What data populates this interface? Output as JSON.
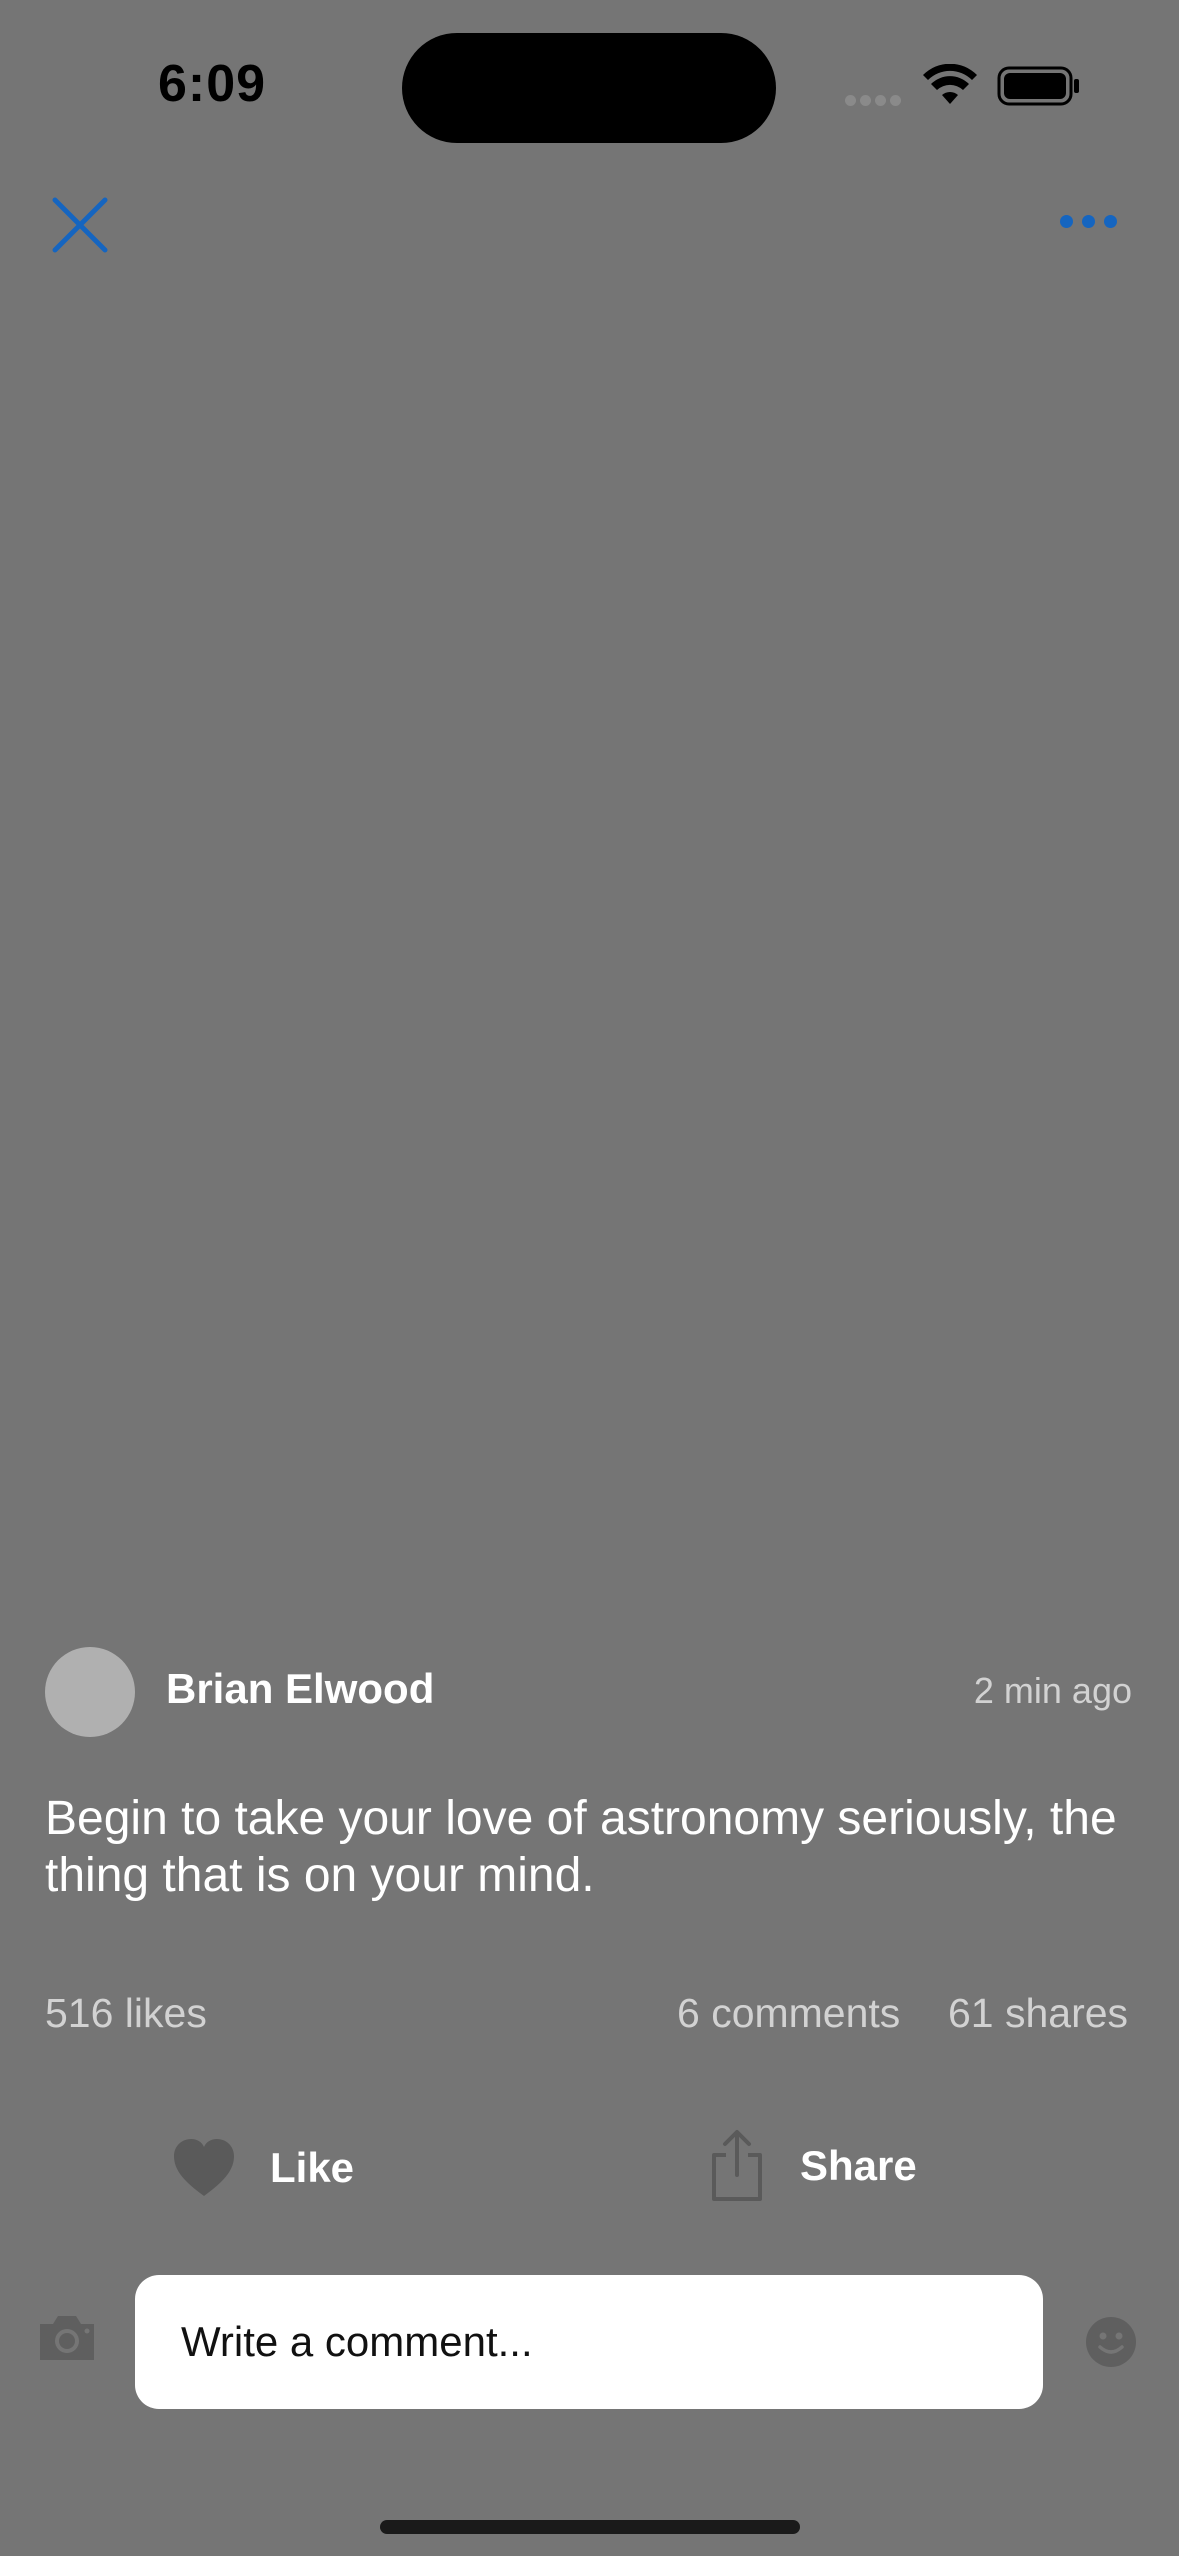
{
  "status_bar": {
    "time": "6:09"
  },
  "nav": {
    "close_icon": "close-icon",
    "more_icon": "more-horizontal-icon",
    "accent_color": "#1565c0"
  },
  "post": {
    "author_name": "Brian Elwood",
    "time_ago": "2 min ago",
    "text": "Begin to take your love of astronomy seriously, the thing that is on your mind.",
    "likes": "516 likes",
    "comments": "6 comments",
    "shares": "61 shares"
  },
  "actions": {
    "like_label": "Like",
    "like_icon": "heart-icon",
    "share_label": "Share",
    "share_icon": "share-icon"
  },
  "comment_bar": {
    "placeholder": "Write a comment...",
    "camera_icon": "camera-icon",
    "emoji_icon": "emoji-icon"
  }
}
